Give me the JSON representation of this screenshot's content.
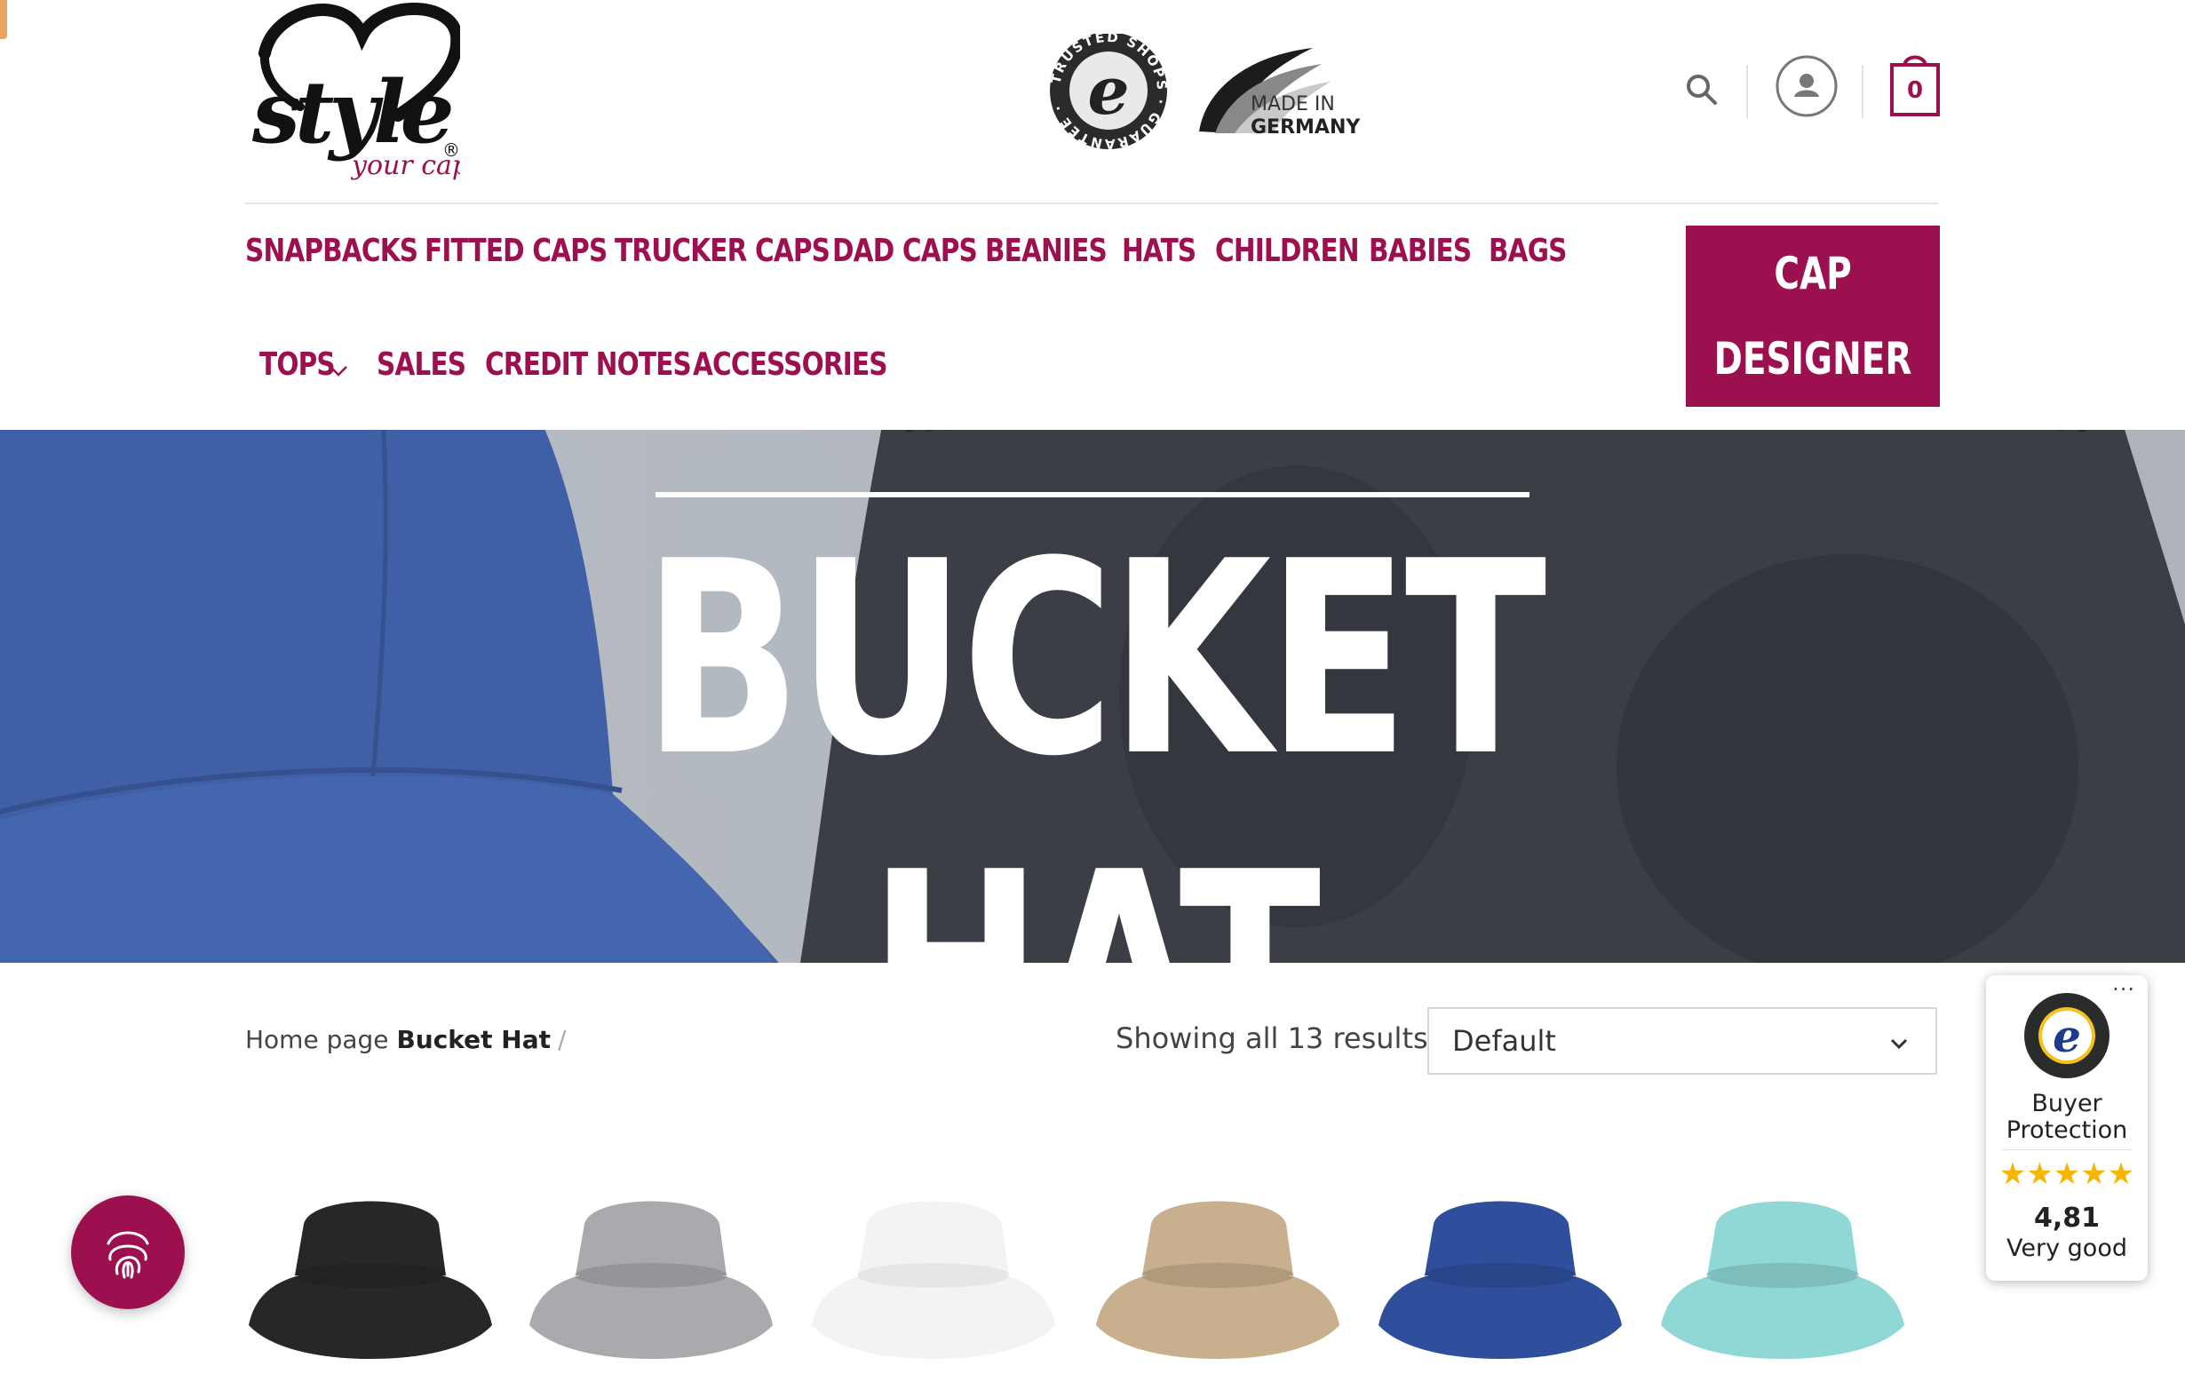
{
  "header": {
    "logo": {
      "word": "style",
      "tagline": "your cap",
      "registered": "®"
    },
    "badges": {
      "trusted_shops_ring": "TRUSTED SHOPS · GUARANTEE ·",
      "trusted_shops_letter": "e",
      "made_in_line1": "MADE IN",
      "made_in_line2": "GERMANY"
    },
    "cart_count": "0",
    "icons": [
      "search-icon",
      "user-icon",
      "cart-icon"
    ]
  },
  "nav": {
    "row1": [
      "SNAPBACKS",
      "FITTED CAPS",
      "TRUCKER CAPS",
      "DAD CAPS",
      "BEANIES",
      "HATS",
      "CHILDREN",
      "BABIES",
      "BAGS"
    ],
    "row2": [
      "TOPS",
      "SALES",
      "CREDIT NOTES",
      "ACCESSORIES"
    ],
    "cta_line1": "CAP",
    "cta_line2": "DESIGNER"
  },
  "hero": {
    "title_line1": "BUCKET",
    "title_line2": "HAT"
  },
  "listing": {
    "breadcrumb_home": "Home page",
    "breadcrumb_current": "Bucket Hat",
    "breadcrumb_sep": "/",
    "result_count": "Showing all 13 results",
    "sort_value": "Default"
  },
  "products": [
    {
      "color": "#262729"
    },
    {
      "color": "#a9aaae"
    },
    {
      "color": "#f3f3f3"
    },
    {
      "color": "#c8b08e"
    },
    {
      "color": "#2f4f9c"
    },
    {
      "color": "#8fd8d6"
    }
  ],
  "trusted_widget": {
    "label_line1": "Buyer",
    "label_line2": "Protection",
    "stars": "★★★★★",
    "score": "4,81",
    "grade": "Very good",
    "menu": "···"
  },
  "colors": {
    "brand": "#9c1050",
    "star": "#f7b500"
  }
}
